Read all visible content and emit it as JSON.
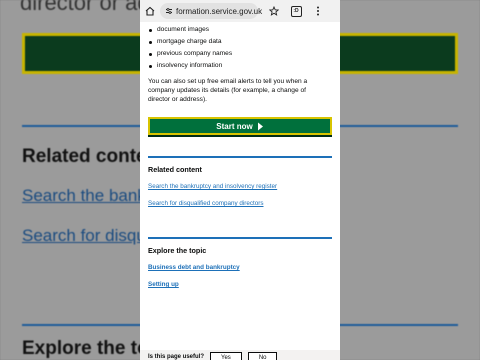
{
  "background": {
    "top_text": "director or addr",
    "heading_related": "Related conte",
    "link_1": "Search the bankr",
    "link_2": "Search for disqua",
    "heading_explore": "Explore the to"
  },
  "browser": {
    "url": "formation.service.gov.uk",
    "tab_count": ":D",
    "icons": [
      "home-icon",
      "site-settings-icon",
      "star-icon",
      "tabs-icon",
      "more-vert-icon"
    ]
  },
  "content": {
    "bullets": [
      "document images",
      "mortgage charge data",
      "previous company names",
      "insolvency information"
    ],
    "paragraph": "You can also set up free email alerts to tell you when a company updates its details (for example, a change of director or address).",
    "start_button": "Start now",
    "related": {
      "heading": "Related content",
      "links": [
        "Search the bankruptcy and insolvency register",
        "Search for disqualified company directors"
      ]
    },
    "explore": {
      "heading": "Explore the topic",
      "links": [
        "Business debt and bankruptcy",
        "Setting up"
      ]
    },
    "feedback": {
      "question": "Is this page useful?",
      "yes": "Yes",
      "no": "No"
    }
  },
  "colors": {
    "start_button": "#00703c",
    "focus": "#d8c400",
    "link": "#1d70b8",
    "rule": "#1d70b8"
  }
}
